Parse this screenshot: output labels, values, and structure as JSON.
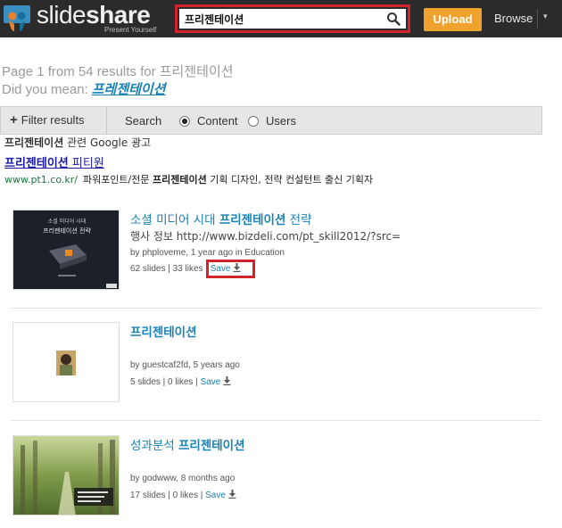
{
  "header": {
    "logo_slide": "slide",
    "logo_share": "share",
    "tagline": "Present Yourself",
    "search_value": "프리젠테이션",
    "upload_label": "Upload",
    "browse_label": "Browse",
    "browse_caret": "▾"
  },
  "summary": {
    "page_text": "Page 1 from 54 results for 프리젠테이션",
    "did_you_mean_label": "Did you mean:",
    "did_you_mean_link": "프레젠테이션"
  },
  "filters": {
    "filter_label": "Filter results",
    "search_label": "Search",
    "options": [
      {
        "label": "Content",
        "selected": true
      },
      {
        "label": "Users",
        "selected": false
      }
    ]
  },
  "ad": {
    "header_bold": "프리젠테이션",
    "header_rest": " 관련 Google 광고",
    "title_bold": "프리젠테이션",
    "title_rest": " 피티원",
    "url": "www.pt1.co.kr/",
    "desc_pre": "파워포인트/전문 ",
    "desc_bold": "프리젠테이션",
    "desc_post": " 기획 디자인, 전략 컨설턴트 출신 기획자"
  },
  "results": [
    {
      "title_pre": "소셜 미디어 시대 ",
      "title_bold": "프리젠테이션",
      "title_post": " 전략",
      "desc": "행사 정보 http://www.bizdeli.com/pt_skill2012/?src=",
      "meta": "by phploveme, 1 year ago in Education",
      "stats": "62 slides | 33 likes |",
      "save": "Save",
      "thumb_line1": "소셜 미디어 시대",
      "thumb_line2": "프리젠테이션 전략"
    },
    {
      "title_pre": "",
      "title_bold": "프리젠테이션",
      "title_post": "",
      "desc": "",
      "meta": "by guestcaf2fd, 5 years ago",
      "stats": "5 slides | 0 likes |",
      "save": "Save"
    },
    {
      "title_pre": "성과분석 ",
      "title_bold": "프리젠테이션",
      "title_post": "",
      "desc": "",
      "meta": "by godwww, 8 months ago",
      "stats": "17 slides | 0 likes |",
      "save": "Save"
    }
  ],
  "colors": {
    "topbar": "#2b2b2b",
    "accent_orange": "#f0a22e",
    "highlight_red": "#d2232a",
    "link_blue": "#1a82b5"
  }
}
